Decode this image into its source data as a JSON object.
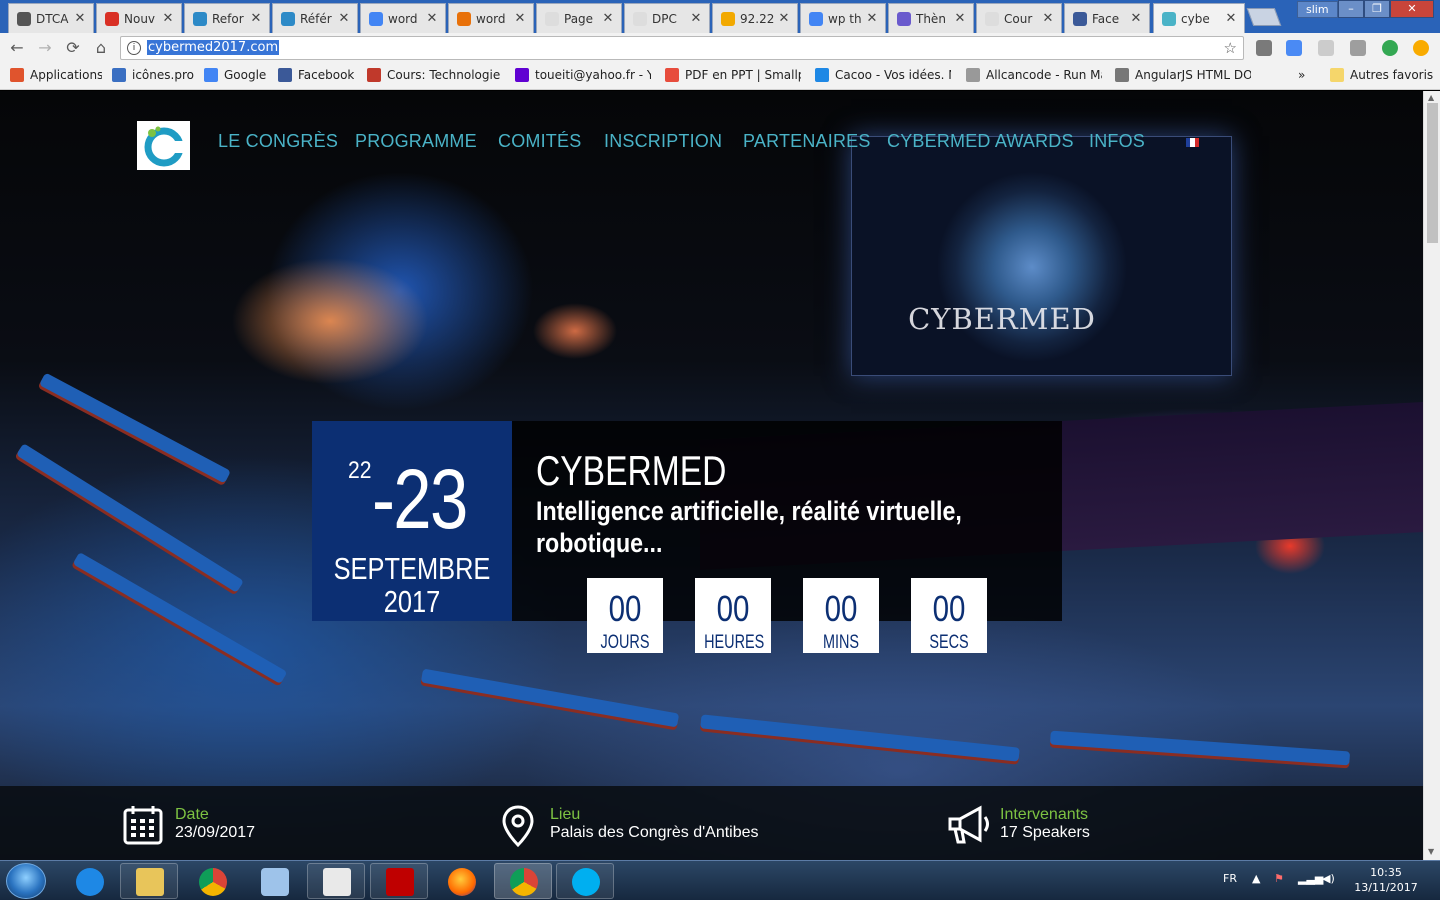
{
  "browser": {
    "tabs": [
      {
        "title": "DTCA",
        "color": "#555555"
      },
      {
        "title": "Nouv",
        "color": "#d93025"
      },
      {
        "title": "Refor",
        "color": "#2d8ac7"
      },
      {
        "title": "Référ",
        "color": "#2d8ac7"
      },
      {
        "title": "word",
        "color": "#4285f4"
      },
      {
        "title": "word",
        "color": "#e8710a"
      },
      {
        "title": "Page",
        "color": "#dddddd"
      },
      {
        "title": "DPC",
        "color": "#dddddd"
      },
      {
        "title": "92.22",
        "color": "#f2a900"
      },
      {
        "title": "wp th",
        "color": "#4285f4"
      },
      {
        "title": "Thèn",
        "color": "#6a5acd"
      },
      {
        "title": "Cour",
        "color": "#dddddd"
      },
      {
        "title": "Face",
        "color": "#3b5998"
      },
      {
        "title": "cybe",
        "color": "#4ab3c7"
      }
    ],
    "window_user": "slim",
    "url": "cybermed2017.com",
    "bookmarks": [
      {
        "label": "Applications",
        "color": "#e0542d"
      },
      {
        "label": "icônes.pro",
        "color": "#3a6fc2"
      },
      {
        "label": "Google",
        "color": "#4285f4"
      },
      {
        "label": "Facebook",
        "color": "#3b5998"
      },
      {
        "label": "Cours: Technologie W",
        "color": "#c0392b"
      },
      {
        "label": "toueiti@yahoo.fr - Ya",
        "color": "#6001d2"
      },
      {
        "label": "PDF en PPT | Smallpd",
        "color": "#e74c3c"
      },
      {
        "label": "Cacoo - Vos idées. N",
        "color": "#1e88e5"
      },
      {
        "label": "Allcancode - Run Ma",
        "color": "#999999"
      },
      {
        "label": "AngularJS HTML DOM",
        "color": "#777777"
      }
    ],
    "bookmarks_more": "»",
    "other_bookmarks": "Autres favoris"
  },
  "site": {
    "nav": [
      "LE CONGRÈS",
      "PROGRAMME",
      "COMITÉS",
      "INSCRIPTION",
      "PARTENAIRES",
      "CYBERMED AWARDS",
      "INFOS"
    ],
    "screen_text": "CYBERMED",
    "event": {
      "day_start": "22",
      "day_end": "-23",
      "month": "SEPTEMBRE",
      "year": "2017",
      "title": "CYBERMED",
      "subtitle": "Intelligence artificielle, réalité virtuelle, robotique..."
    },
    "countdown": [
      {
        "value": "00",
        "label": "JOURS"
      },
      {
        "value": "00",
        "label": "HEURES"
      },
      {
        "value": "00",
        "label": "MINS"
      },
      {
        "value": "00",
        "label": "SECS"
      }
    ],
    "info_bar": {
      "date_label": "Date",
      "date_value": "23/09/2017",
      "place_label": "Lieu",
      "place_value": "Palais des Congrès d'Antibes",
      "speakers_label": "Intervenants",
      "speakers_value": "17 Speakers"
    }
  },
  "taskbar": {
    "language": "FR",
    "time": "10:35",
    "date": "13/11/2017"
  }
}
